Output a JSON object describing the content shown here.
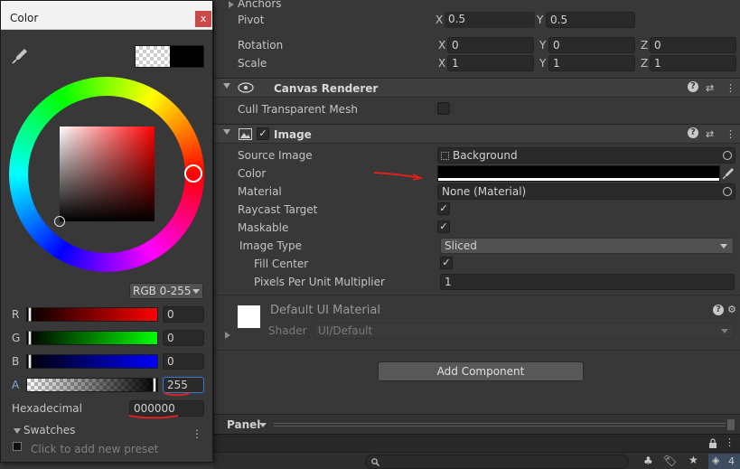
{
  "inspector": {
    "transform": {
      "anchors_label": "Anchors",
      "pivot_label": "Pivot",
      "pivot_x": "0.5",
      "pivot_y": "0.5",
      "rotation_label": "Rotation",
      "rotation_x": "0",
      "rotation_y": "0",
      "rotation_z": "0",
      "scale_label": "Scale",
      "scale_x": "1",
      "scale_y": "1",
      "scale_z": "1",
      "axis_x": "X",
      "axis_y": "Y",
      "axis_z": "Z"
    },
    "canvas_renderer": {
      "title": "Canvas Renderer",
      "cull_label": "Cull Transparent Mesh",
      "cull_checked": false
    },
    "image": {
      "title": "Image",
      "source_image_label": "Source Image",
      "source_image_value": "Background",
      "color_label": "Color",
      "color_value": "#000000",
      "material_label": "Material",
      "material_value": "None (Material)",
      "raycast_label": "Raycast Target",
      "raycast_checked": true,
      "maskable_label": "Maskable",
      "maskable_checked": true,
      "image_type_label": "Image Type",
      "image_type_value": "Sliced",
      "fill_center_label": "Fill Center",
      "fill_center_checked": true,
      "ppu_label": "Pixels Per Unit Multiplier",
      "ppu_value": "1"
    },
    "material": {
      "title": "Default UI Material",
      "shader_label": "Shader",
      "shader_value": "UI/Default"
    },
    "add_component_label": "Add Component",
    "panel_label": "Panel"
  },
  "color_picker": {
    "title": "Color",
    "close_glyph": "x",
    "mode": "RGB 0-255",
    "r_label": "R",
    "r_value": "0",
    "g_label": "G",
    "g_value": "0",
    "b_label": "B",
    "b_value": "0",
    "a_label": "A",
    "a_value": "255",
    "hex_label": "Hexadecimal",
    "hex_value": "000000",
    "swatches_label": "Swatches",
    "add_preset_label": "Click to add new preset"
  },
  "statusbar": {
    "layer_count": "4"
  },
  "colors": {
    "annotation_red": "#e02020",
    "background": "#383838",
    "header": "#3e3e3e"
  },
  "icons": [
    "eyedropper-icon",
    "eye-icon",
    "image-icon",
    "help-icon",
    "preset-icon",
    "kebab-menu-icon",
    "object-picker-icon",
    "lock-icon",
    "search-icon",
    "tag-icon",
    "star-icon",
    "layers-icon"
  ]
}
